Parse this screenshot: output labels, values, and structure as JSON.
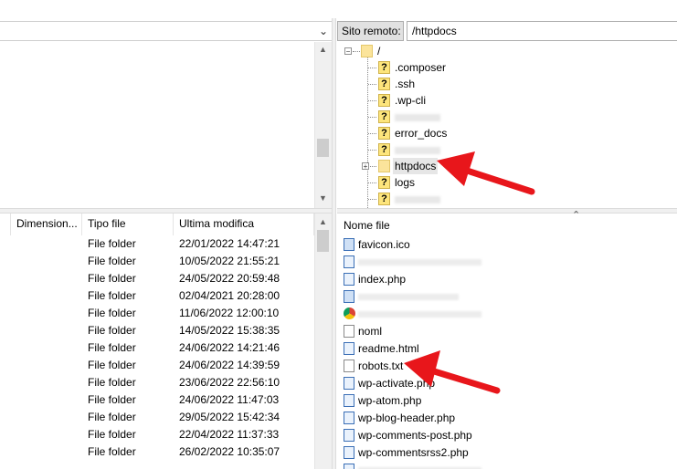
{
  "local": {
    "path_value": "",
    "list_headers": {
      "size": "Dimension...",
      "type": "Tipo file",
      "modified": "Ultima modifica"
    },
    "rows": [
      {
        "type": "File folder",
        "modified": "22/01/2022 14:47:21"
      },
      {
        "type": "File folder",
        "modified": "10/05/2022 21:55:21"
      },
      {
        "type": "File folder",
        "modified": "24/05/2022 20:59:48"
      },
      {
        "type": "File folder",
        "modified": "02/04/2021 20:28:00"
      },
      {
        "type": "File folder",
        "modified": "11/06/2022 12:00:10"
      },
      {
        "type": "File folder",
        "modified": "14/05/2022 15:38:35"
      },
      {
        "type": "File folder",
        "modified": "24/06/2022 14:21:46"
      },
      {
        "type": "File folder",
        "modified": "24/06/2022 14:39:59"
      },
      {
        "type": "File folder",
        "modified": "23/06/2022 22:56:10"
      },
      {
        "type": "File folder",
        "modified": "24/06/2022 11:47:03"
      },
      {
        "type": "File folder",
        "modified": "29/05/2022 15:42:34"
      },
      {
        "type": "File folder",
        "modified": "22/04/2022 11:37:33"
      },
      {
        "type": "File folder",
        "modified": "26/02/2022 10:35:07"
      }
    ]
  },
  "remote": {
    "label": "Sito remoto:",
    "path_value": "/httpdocs",
    "tree": [
      {
        "name": "/",
        "icon": "folder-icon",
        "level": 0
      },
      {
        "name": ".composer",
        "icon": "unknown-folder-icon",
        "level": 1
      },
      {
        "name": ".ssh",
        "icon": "unknown-folder-icon",
        "level": 1
      },
      {
        "name": ".wp-cli",
        "icon": "unknown-folder-icon",
        "level": 1
      },
      {
        "name": "",
        "icon": "unknown-folder-icon",
        "level": 1
      },
      {
        "name": "error_docs",
        "icon": "unknown-folder-icon",
        "level": 1
      },
      {
        "name": "",
        "icon": "unknown-folder-icon",
        "level": 1
      },
      {
        "name": "httpdocs",
        "icon": "folder-icon",
        "level": 1
      },
      {
        "name": "logs",
        "icon": "unknown-folder-icon",
        "level": 1
      },
      {
        "name": "",
        "icon": "unknown-folder-icon",
        "level": 1
      }
    ],
    "list_header": "Nome file",
    "files": [
      {
        "name": "favicon.ico",
        "icon": "image-file-icon"
      },
      {
        "name": "",
        "icon": "php-file-icon"
      },
      {
        "name": "index.php",
        "icon": "php-file-icon"
      },
      {
        "name": "",
        "icon": "image-file-icon"
      },
      {
        "name": "",
        "icon": "chrome-html-icon"
      },
      {
        "name": "noml",
        "icon": "text-file-icon"
      },
      {
        "name": "readme.html",
        "icon": "php-file-icon"
      },
      {
        "name": "robots.txt",
        "icon": "text-file-icon"
      },
      {
        "name": "wp-activate.php",
        "icon": "php-file-icon"
      },
      {
        "name": "wp-atom.php",
        "icon": "php-file-icon"
      },
      {
        "name": "wp-blog-header.php",
        "icon": "php-file-icon"
      },
      {
        "name": "wp-comments-post.php",
        "icon": "php-file-icon"
      },
      {
        "name": "wp-commentsrss2.php",
        "icon": "php-file-icon"
      },
      {
        "name": "",
        "icon": "php-file-icon"
      }
    ]
  },
  "colors": {
    "annotation_arrow": "#e8161b",
    "folder": "#fbe49b",
    "unknown_folder": "#fde57c"
  }
}
